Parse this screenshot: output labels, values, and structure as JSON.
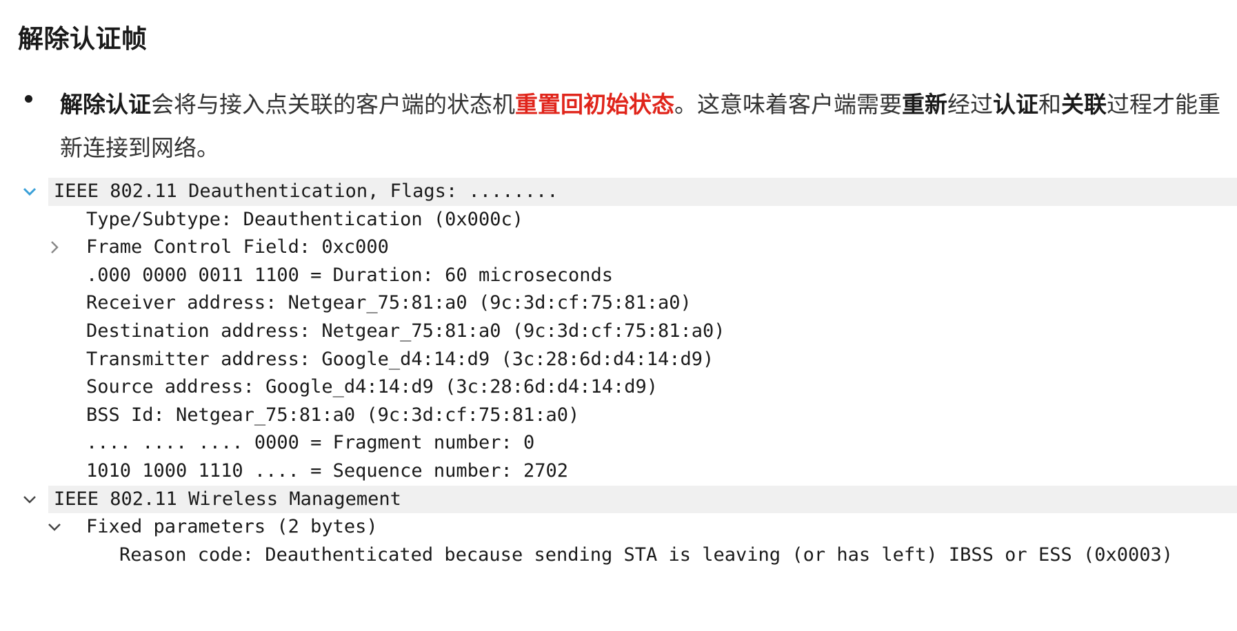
{
  "heading": "解除认证帧",
  "bullet": {
    "segments": [
      {
        "text": "解除认证",
        "style": "bold"
      },
      {
        "text": "会将与接入点关联的客户端的状态机",
        "style": "normal"
      },
      {
        "text": "重置回初始状态",
        "style": "red"
      },
      {
        "text": "。这意味着客户端需要",
        "style": "normal"
      },
      {
        "text": "重新",
        "style": "bold"
      },
      {
        "text": "经过",
        "style": "normal"
      },
      {
        "text": "认证",
        "style": "bold"
      },
      {
        "text": "和",
        "style": "normal"
      },
      {
        "text": "关联",
        "style": "bold"
      },
      {
        "text": "过程才能重新连接到网络。",
        "style": "normal"
      }
    ]
  },
  "packet": {
    "deauth_header": "IEEE 802.11 Deauthentication, Flags: ........",
    "type_subtype": "Type/Subtype: Deauthentication (0x000c)",
    "frame_control": "Frame Control Field: 0xc000",
    "duration": ".000 0000 0011 1100 = Duration: 60 microseconds",
    "receiver": "Receiver address: Netgear_75:81:a0 (9c:3d:cf:75:81:a0)",
    "destination": "Destination address: Netgear_75:81:a0 (9c:3d:cf:75:81:a0)",
    "transmitter": "Transmitter address: Google_d4:14:d9 (3c:28:6d:d4:14:d9)",
    "source": "Source address: Google_d4:14:d9 (3c:28:6d:d4:14:d9)",
    "bss_id": "BSS Id: Netgear_75:81:a0 (9c:3d:cf:75:81:a0)",
    "fragment": ".... .... .... 0000 = Fragment number: 0",
    "sequence": "1010 1000 1110 .... = Sequence number: 2702",
    "mgmt_header": "IEEE 802.11 Wireless Management",
    "fixed_params": "Fixed parameters (2 bytes)",
    "reason_code": "Reason code: Deauthenticated because sending STA is leaving (or has left) IBSS or ESS (0x0003)"
  },
  "colors": {
    "accent_red": "#e0251b",
    "expand_blue": "#3aa0d8",
    "header_bg": "#f0f0f0"
  },
  "icons": {
    "expanded_selected": "chevron-down-icon",
    "collapsed": "chevron-right-icon"
  }
}
